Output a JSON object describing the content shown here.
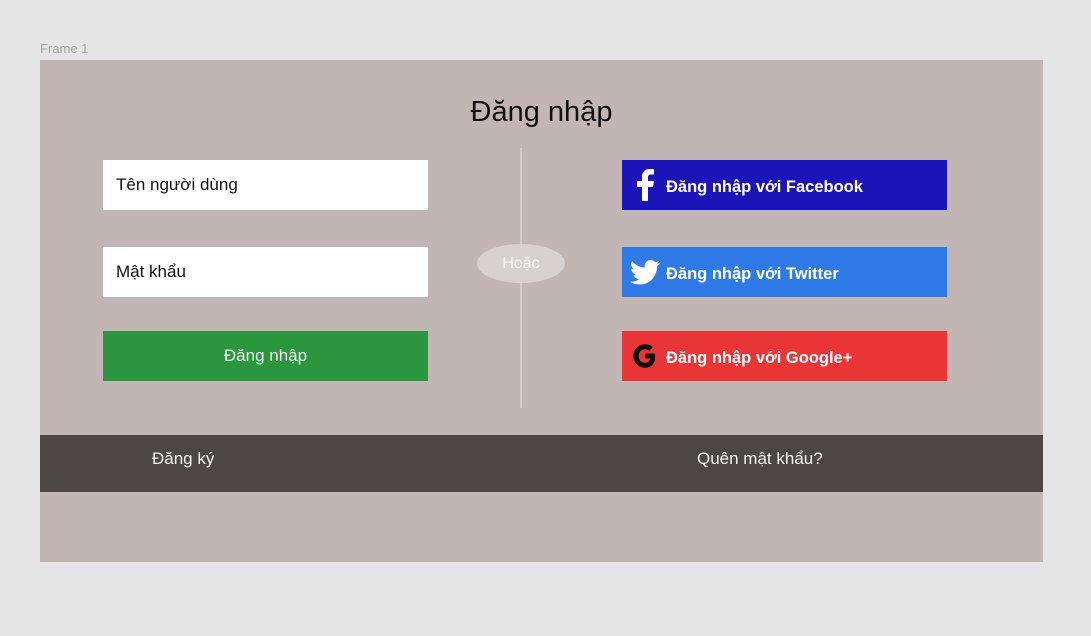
{
  "frame": {
    "label": "Frame 1"
  },
  "header": {
    "title": "Đăng nhập"
  },
  "form": {
    "username_placeholder": "Tên người dùng",
    "password_placeholder": "Mật khẩu",
    "login_label": "Đăng nhập"
  },
  "separator": {
    "label": "Hoặc"
  },
  "social": {
    "facebook": {
      "label": "Đăng nhập với Facebook",
      "icon": "facebook-icon",
      "color": "#1c14b8"
    },
    "twitter": {
      "label": "Đăng nhập với Twitter",
      "icon": "twitter-bird-icon",
      "color": "#2f7ae6"
    },
    "google": {
      "label": "Đăng nhập với Google+",
      "icon": "google-g-icon",
      "color": "#e93535"
    }
  },
  "footer": {
    "register_label": "Đăng ký",
    "forgot_label": "Quên mật khẩu?"
  },
  "colors": {
    "page_background": "#e5e5e5",
    "frame_background": "#c2b6b4",
    "login_button": "#2a963d",
    "footer_bar": "#4c4646"
  }
}
